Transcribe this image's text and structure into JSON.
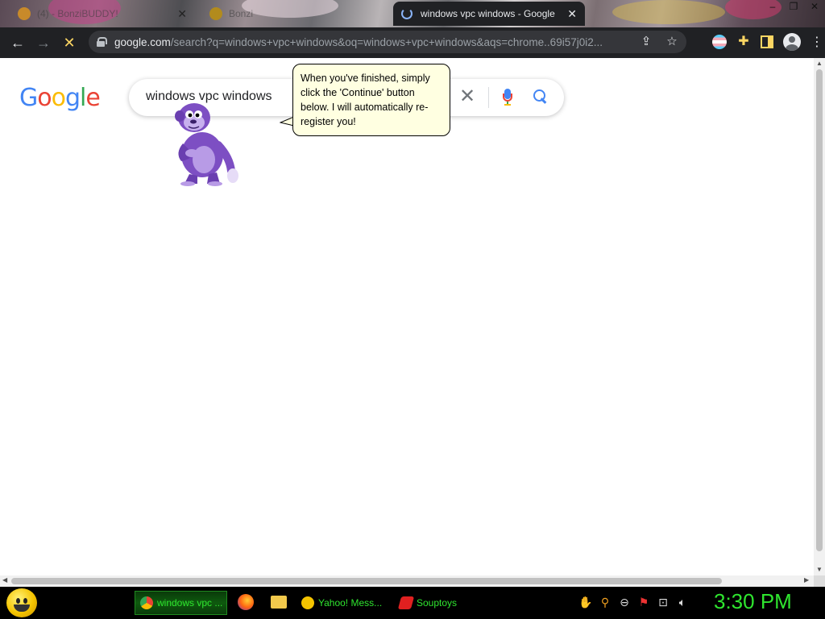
{
  "browser": {
    "tabs": [
      {
        "title": "(4) - BonziBUDDY!",
        "active": false
      },
      {
        "title": "Bonzi",
        "active": false
      },
      {
        "title": "windows vpc windows - Google",
        "active": true
      }
    ],
    "window_controls": [
      "–",
      "❐",
      "✕"
    ],
    "url_host": "google.com",
    "url_path": "/search?q=windows+vpc+windows&oq=windows+vpc+windows&aqs=chrome..69i57j0i2..."
  },
  "page": {
    "logo": [
      "G",
      "o",
      "o",
      "g",
      "l",
      "e"
    ],
    "search_query": "windows vpc windows",
    "clear_glyph": "✕"
  },
  "bonzi": {
    "balloon_text": "When you've finished, simply click the 'Continue' button below. I will automatically re-register you!"
  },
  "taskbar": {
    "tasks": [
      {
        "label": "windows vpc ...",
        "active": true
      },
      {
        "label": "Yahoo! Mess...",
        "active": false
      },
      {
        "label": "Souptoys",
        "active": false
      }
    ],
    "clock": "3:30 PM"
  },
  "colors": {
    "accent_green": "#2fe52f",
    "chrome_dark": "#202124",
    "balloon_bg": "#ffffe1",
    "bonzi_purple": "#7d4fc3"
  },
  "icons": [
    "back-arrow-icon",
    "forward-arrow-icon",
    "stop-icon",
    "lock-icon",
    "share-icon",
    "star-icon",
    "trans-flag-icon",
    "puzzle-icon",
    "side-panel-icon",
    "profile-icon",
    "kebab-icon",
    "clear-icon",
    "microphone-icon",
    "search-icon",
    "chrome-icon",
    "firefox-icon",
    "folder-icon",
    "yahoo-messenger-icon",
    "souptoys-icon",
    "network-icon",
    "volume-icon"
  ]
}
